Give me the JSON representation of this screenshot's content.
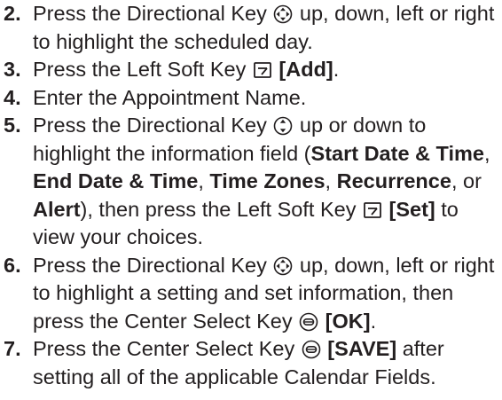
{
  "steps": [
    {
      "number": "2.",
      "parts": {
        "a": "Press the Directional Key",
        "icon": "directional-4way-key-icon",
        "b": "up, down, left or right to highlight the scheduled day."
      }
    },
    {
      "number": "3.",
      "parts": {
        "a": "Press the Left Soft Key",
        "icon": "left-soft-key-icon",
        "key_label": "[Add]",
        "end": "."
      }
    },
    {
      "number": "4.",
      "parts": {
        "a": "Enter the Appointment Name."
      }
    },
    {
      "number": "5.",
      "parts": {
        "a": "Press the Directional Key",
        "icon": "directional-updown-key-icon",
        "b": "up or down to highlight the information field (",
        "f1": "Start Date & Time",
        "sep1": ", ",
        "f2": "End Date & Time",
        "sep2": ", ",
        "f3": "Time Zones",
        "sep3": ", ",
        "f4": "Recurrence",
        "sep4": ", or ",
        "f5": "Alert",
        "c": "), then press the Left Soft Key",
        "icon2": "left-soft-key-icon",
        "key_label": "[Set]",
        "d": "to view your choices."
      }
    },
    {
      "number": "6.",
      "parts": {
        "a": "Press the Directional Key",
        "icon": "directional-4way-key-icon",
        "b": "up, down, left or right to highlight a setting and set information, then press the Center Select Key",
        "icon2": "center-select-key-icon",
        "key_label": "[OK]",
        "end": "."
      }
    },
    {
      "number": "7.",
      "parts": {
        "a": "Press the Center Select Key",
        "icon": "center-select-key-icon",
        "key_label": "[SAVE]",
        "b": "after setting all of the applicable Calendar Fields."
      }
    }
  ]
}
